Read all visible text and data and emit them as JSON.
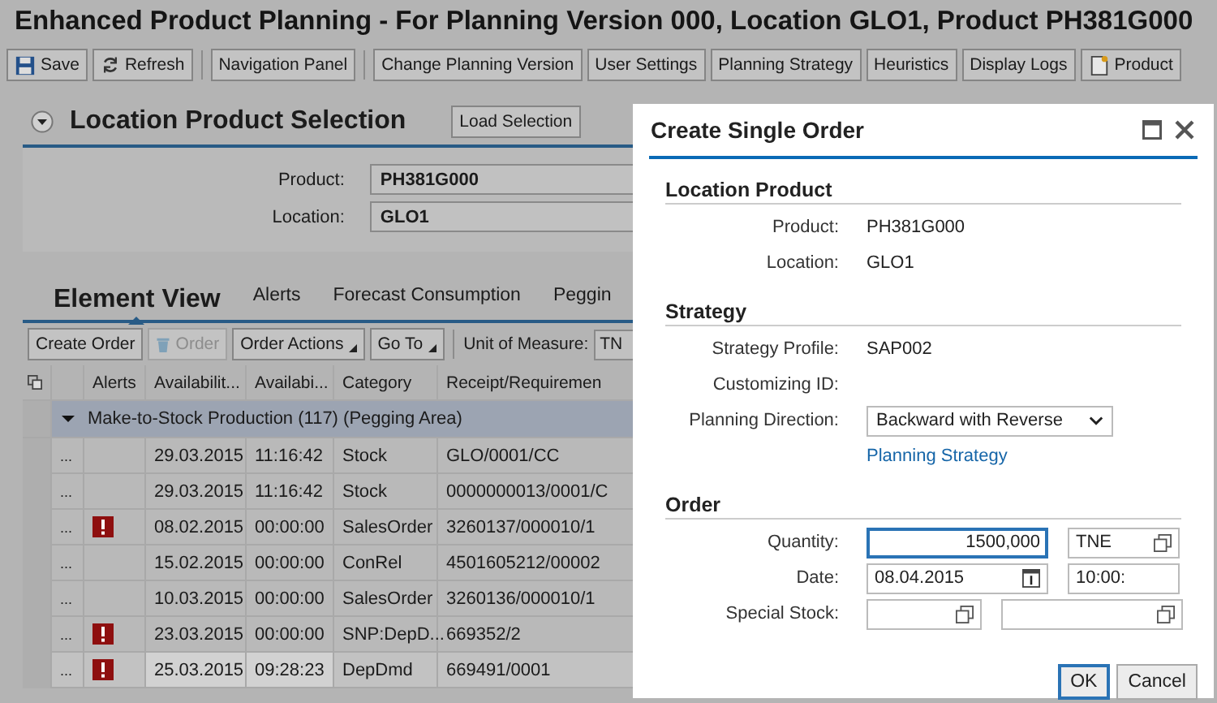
{
  "window": {
    "title": "Enhanced Product Planning - For Planning Version 000, Location GLO1, Product PH381G000"
  },
  "toolbar": [
    [
      {
        "label": "Save"
      },
      {
        "label": "Refresh"
      }
    ],
    [
      {
        "label": "Navigation Panel"
      }
    ],
    [
      {
        "label": "Change Planning Version"
      },
      {
        "label": "User Settings"
      },
      {
        "label": "Planning Strategy"
      },
      {
        "label": "Heuristics"
      },
      {
        "label": "Display Logs"
      },
      {
        "label": "Product"
      }
    ]
  ],
  "location_product_selection": {
    "title": "Location Product Selection",
    "expanded": true,
    "button": "Load Selection",
    "fields": [
      {
        "label": "Product:",
        "value": "PH381G000"
      },
      {
        "label": "Location:",
        "value": "GLO1"
      }
    ]
  },
  "element_view": {
    "tabs": [
      {
        "label": "Element View",
        "selected": true
      },
      {
        "label": "Alerts",
        "selected": false
      },
      {
        "label": "Forecast Consumption",
        "selected": false
      },
      {
        "label": "Peggin",
        "selected": false
      }
    ],
    "actions": [
      {
        "label": "Create Order",
        "disabled": false,
        "menu": false
      },
      {
        "label": "Order",
        "disabled": true,
        "menu": false
      },
      {
        "label": "Order Actions",
        "disabled": false,
        "menu": true
      },
      {
        "label": "Go To",
        "disabled": false,
        "menu": true
      }
    ],
    "unit_label": "Unit of Measure:",
    "unit_value": "TN",
    "table": {
      "columns": [
        "Alerts",
        "Availabilit...",
        "Availabi...",
        "Category",
        "Receipt/Requiremen"
      ],
      "group": {
        "label": "Make-to-Stock Production (117) (Pegging Area)",
        "expanded": true
      },
      "rows": [
        {
          "menu": "...",
          "alert": false,
          "date": "29.03.2015",
          "time": "11:16:42",
          "category": "Stock",
          "receipt": "GLO/0001/CC",
          "selected": false
        },
        {
          "menu": "...",
          "alert": false,
          "date": "29.03.2015",
          "time": "11:16:42",
          "category": "Stock",
          "receipt": "0000000013/0001/C",
          "selected": false
        },
        {
          "menu": "...",
          "alert": true,
          "date": "08.02.2015",
          "time": "00:00:00",
          "category": "SalesOrder",
          "receipt": "3260137/000010/1",
          "selected": false
        },
        {
          "menu": "...",
          "alert": false,
          "date": "15.02.2015",
          "time": "00:00:00",
          "category": "ConRel",
          "receipt": "4501605212/00002",
          "selected": false
        },
        {
          "menu": "...",
          "alert": false,
          "date": "10.03.2015",
          "time": "00:00:00",
          "category": "SalesOrder",
          "receipt": "3260136/000010/1",
          "selected": false
        },
        {
          "menu": "...",
          "alert": true,
          "date": "23.03.2015",
          "time": "00:00:00",
          "category": "SNP:DepD...",
          "receipt": "669352/2",
          "selected": false
        },
        {
          "menu": "...",
          "alert": true,
          "date": "25.03.2015",
          "time": "09:28:23",
          "category": "DepDmd",
          "receipt": "669491/0001",
          "selected": true
        }
      ]
    }
  },
  "dialog": {
    "title": "Create Single Order",
    "sections": [
      {
        "title": "Location Product",
        "rows": [
          {
            "label": "Product:",
            "kind": "text",
            "value": "PH381G000"
          },
          {
            "label": "Location:",
            "kind": "text",
            "value": "GLO1"
          }
        ]
      },
      {
        "title": "Strategy",
        "rows": [
          {
            "label": "Strategy Profile:",
            "kind": "text",
            "value": "SAP002"
          },
          {
            "label": "Customizing ID:",
            "kind": "text"
          },
          {
            "label": "Planning Direction:",
            "kind": "select",
            "value": "Backward with Reverse"
          },
          {
            "kind": "link",
            "value": "Planning Strategy"
          }
        ]
      },
      {
        "title": "Order",
        "rows": [
          {
            "label": "Quantity:",
            "kind": "inputs",
            "fields": [
              {
                "kind": "number",
                "value": "1500,000",
                "focused": true
              },
              {
                "kind": "value-help",
                "value": "TNE",
                "focused": false
              }
            ]
          },
          {
            "label": "Date:",
            "kind": "inputs",
            "fields": [
              {
                "kind": "date",
                "value": "08.04.2015",
                "focused": false
              },
              {
                "kind": "plain",
                "value": "10:00:",
                "focused": false
              }
            ]
          },
          {
            "label": "Special Stock:",
            "kind": "inputs",
            "fields": [
              {
                "kind": "value-help",
                "focused": false
              },
              {
                "kind": "value-help",
                "focused": false
              }
            ]
          }
        ]
      }
    ],
    "buttons": [
      {
        "label": "OK",
        "default": true
      },
      {
        "label": "Cancel",
        "default": false
      }
    ]
  }
}
